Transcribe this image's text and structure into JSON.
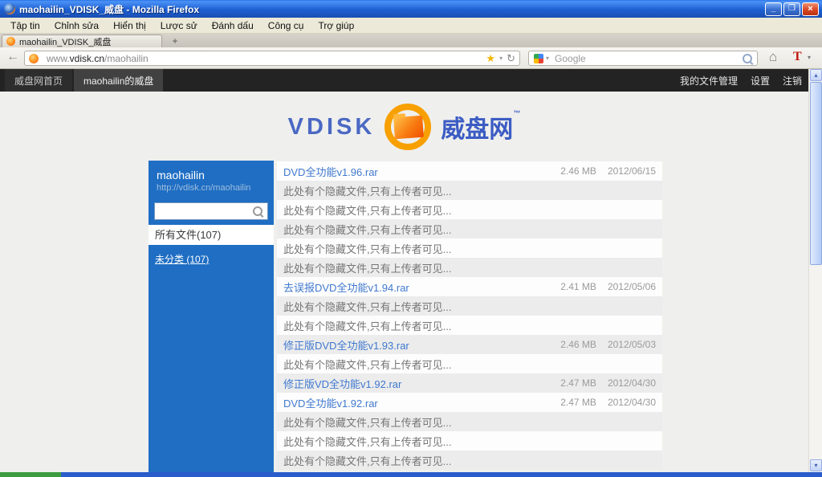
{
  "window": {
    "title": "maohailin_VDISK_威盘 - Mozilla Firefox",
    "controls": {
      "minimize": "_",
      "restore": "❒",
      "close": "×"
    }
  },
  "menubar": {
    "items": [
      "Tập tin",
      "Chỉnh sửa",
      "Hiển thị",
      "Lược sử",
      "Đánh dấu",
      "Công cụ",
      "Trợ giúp"
    ]
  },
  "tabbar": {
    "active_tab": "maohailin_VDISK_威盘",
    "new_tab": "+"
  },
  "toolbar": {
    "back_glyph": "←",
    "url": {
      "pre": "www.",
      "domain": "vdisk.cn",
      "path": "/maohailin"
    },
    "bookmark_star": "★",
    "dropdown_glyph": "▾",
    "reload_glyph": "↻",
    "search": {
      "placeholder": "Google"
    },
    "home_glyph": "⌂",
    "addon_label": "T"
  },
  "site_nav": {
    "tabs": [
      {
        "label": "威盘网首页"
      },
      {
        "label": "maohailin的威盘"
      }
    ],
    "links": [
      {
        "label": "我的文件管理"
      },
      {
        "label": "设置"
      },
      {
        "label": "注销"
      }
    ]
  },
  "logo": {
    "latin": "VDISK",
    "cjk": "威盘网",
    "tm": "™"
  },
  "sidebar": {
    "username": "maohailin",
    "profile_url": "http://vdisk.cn/maohailin",
    "search_value": "",
    "all_files_label": "所有文件(107)",
    "uncategorized_label": "未分类 (107)"
  },
  "file_list": {
    "rows": [
      {
        "kind": "file",
        "name": "DVD全功能v1.96.rar",
        "size": "2.46 MB",
        "date": "2012/06/15"
      },
      {
        "kind": "hidden",
        "text": "此处有个隐藏文件,只有上传者可见..."
      },
      {
        "kind": "hidden",
        "text": "此处有个隐藏文件,只有上传者可见..."
      },
      {
        "kind": "hidden",
        "text": "此处有个隐藏文件,只有上传者可见..."
      },
      {
        "kind": "hidden",
        "text": "此处有个隐藏文件,只有上传者可见..."
      },
      {
        "kind": "hidden",
        "text": "此处有个隐藏文件,只有上传者可见..."
      },
      {
        "kind": "file",
        "name": "去误报DVD全功能v1.94.rar",
        "size": "2.41 MB",
        "date": "2012/05/06"
      },
      {
        "kind": "hidden",
        "text": "此处有个隐藏文件,只有上传者可见..."
      },
      {
        "kind": "hidden",
        "text": "此处有个隐藏文件,只有上传者可见..."
      },
      {
        "kind": "file",
        "name": "修正版DVD全功能v1.93.rar",
        "size": "2.46 MB",
        "date": "2012/05/03"
      },
      {
        "kind": "hidden",
        "text": "此处有个隐藏文件,只有上传者可见..."
      },
      {
        "kind": "file",
        "name": "修正版VD全功能v1.92.rar",
        "size": "2.47 MB",
        "date": "2012/04/30"
      },
      {
        "kind": "file",
        "name": "DVD全功能v1.92.rar",
        "size": "2.47 MB",
        "date": "2012/04/30"
      },
      {
        "kind": "hidden",
        "text": "此处有个隐藏文件,只有上传者可见..."
      },
      {
        "kind": "hidden",
        "text": "此处有个隐藏文件,只有上传者可见..."
      },
      {
        "kind": "hidden",
        "text": "此处有个隐藏文件,只有上传者可见..."
      }
    ]
  },
  "colors": {
    "sidebar_blue": "#1f6ec3",
    "link_blue": "#4079cf",
    "logo_orange": "#f7a000",
    "logo_blue": "#3c5cc4",
    "taskbar_blue": "#2a5ccc",
    "start_green": "#3d9c40",
    "row_gray": "#ececec"
  }
}
